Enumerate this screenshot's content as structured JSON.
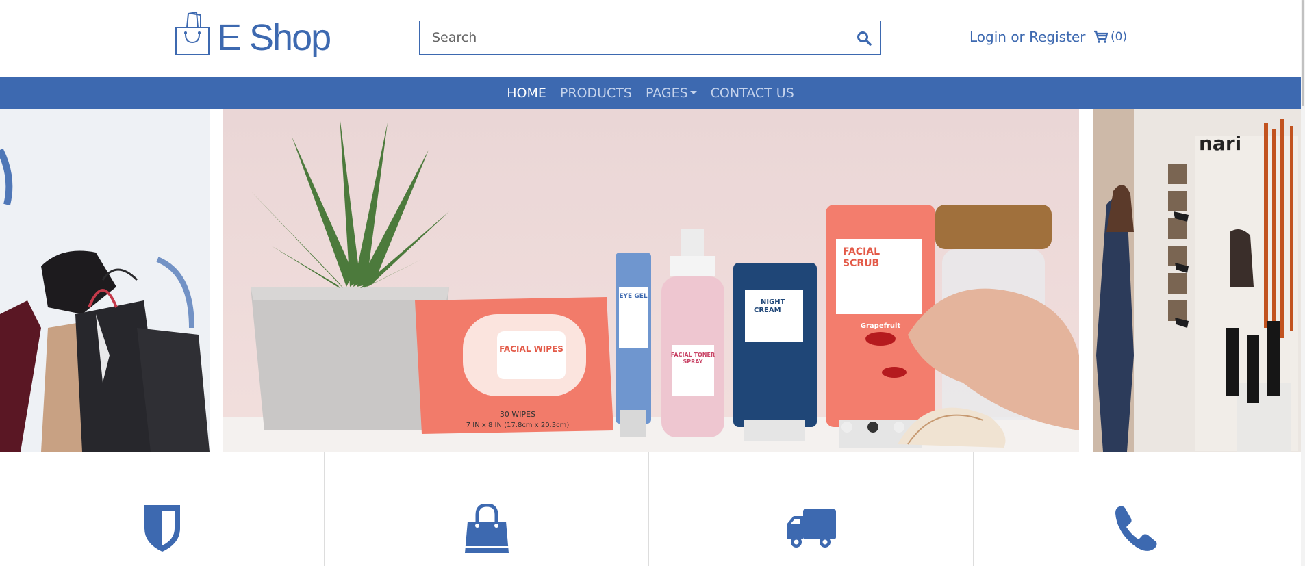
{
  "brand": {
    "name": "E Shop",
    "color": "#3d69b0"
  },
  "search": {
    "placeholder": "Search",
    "icon": "search-icon"
  },
  "account": {
    "login_register": "Login or Register"
  },
  "cart": {
    "icon": "cart-icon",
    "count_label": "(0)"
  },
  "nav": {
    "items": [
      {
        "label": "HOME",
        "active": true
      },
      {
        "label": "PRODUCTS",
        "active": false
      },
      {
        "label": "PAGES",
        "active": false,
        "dropdown": true
      },
      {
        "label": "CONTACT US",
        "active": false
      }
    ]
  },
  "carousel": {
    "slides": [
      {
        "position": "previous"
      },
      {
        "position": "current",
        "product_labels": [
          "EYE GEL",
          "FACIAL WIPES",
          "FACIAL TONER SPRAY",
          "NIGHT CREAM",
          "FACIAL SCRUB",
          "30 WIPES",
          "7 IN x 8 IN (17.8cm x 20.3cm)",
          "Grapefruit"
        ]
      },
      {
        "position": "next",
        "sign_text": "nari"
      }
    ],
    "active_index": 1,
    "dot_count": 3
  },
  "features": [
    {
      "icon": "shield-icon"
    },
    {
      "icon": "shopping-bag-icon"
    },
    {
      "icon": "truck-icon"
    },
    {
      "icon": "phone-icon"
    }
  ]
}
